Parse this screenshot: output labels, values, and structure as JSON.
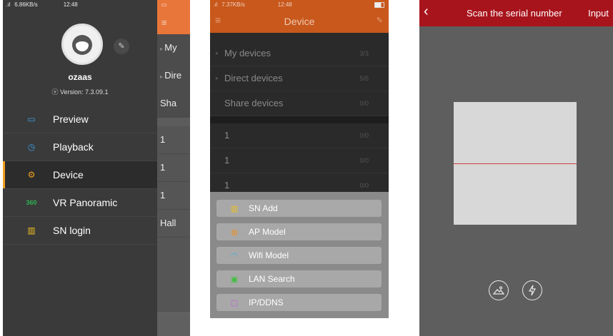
{
  "phone1": {
    "status": {
      "speed": "6.86KB/s",
      "time": "12:48"
    },
    "user": {
      "name": "ozaas",
      "version": "Version: 7.3.09.1"
    },
    "nav": [
      {
        "label": "Preview",
        "icon": "camera-icon",
        "color": "#3aa0e8"
      },
      {
        "label": "Playback",
        "icon": "playback-icon",
        "color": "#3aa0e8"
      },
      {
        "label": "Device",
        "icon": "gear-icon",
        "color": "#f0a020",
        "active": true
      },
      {
        "label": "VR Panoramic",
        "icon": "vr-360-icon",
        "color": "#30b050"
      },
      {
        "label": "SN login",
        "icon": "barcode-icon",
        "color": "#f0c020"
      }
    ],
    "behind_rows": [
      "My",
      "Dire",
      "Sha",
      "1",
      "1",
      "1",
      "Hall"
    ]
  },
  "phone2": {
    "status": {
      "speed": "7.37KB/s",
      "time": "12:48"
    },
    "header_title": "Device",
    "groups": [
      {
        "name": "My devices",
        "count": "3/3"
      },
      {
        "name": "Direct devices",
        "count": "5/5"
      },
      {
        "name": "Share devices",
        "count": "0/0"
      }
    ],
    "device_rows": [
      {
        "name": "1",
        "count": "0/0"
      },
      {
        "name": "1",
        "count": "0/0"
      },
      {
        "name": "1",
        "count": "0/0"
      }
    ],
    "sheet": [
      {
        "label": "SN Add",
        "icon": "barcode-icon",
        "color": "#f0c020"
      },
      {
        "label": "AP Model",
        "icon": "globe-icon",
        "color": "#f09020"
      },
      {
        "label": "Wifi Model",
        "icon": "wifi-icon",
        "color": "#30b8e0"
      },
      {
        "label": "LAN Search",
        "icon": "lan-icon",
        "color": "#40c040"
      },
      {
        "label": "IP/DDNS",
        "icon": "ip-icon",
        "color": "#c060e0"
      }
    ]
  },
  "phone3": {
    "title": "Scan the serial number",
    "input_label": "Input",
    "accent": "#a8141c"
  }
}
